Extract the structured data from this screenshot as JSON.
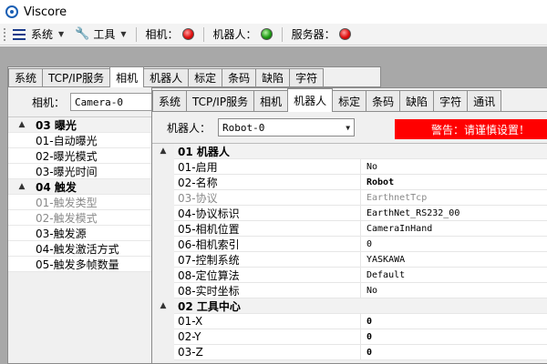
{
  "window": {
    "title": "Viscore"
  },
  "toolbar": {
    "system_label": "系统",
    "tools_label": "工具",
    "camera_label": "相机：",
    "camera_status": "red",
    "robot_label": "机器人：",
    "robot_status": "green",
    "server_label": "服务器：",
    "server_status": "red"
  },
  "back_panel": {
    "tabs": [
      "系统",
      "TCP/IP服务",
      "相机",
      "机器人",
      "标定",
      "条码",
      "缺陷",
      "字符"
    ],
    "active_tab": "相机",
    "camera_label": "相机：",
    "camera_value": "Camera-0",
    "rows": [
      {
        "label": "03  曝光",
        "group": true
      },
      {
        "label": "01-自动曝光"
      },
      {
        "label": "02-曝光模式"
      },
      {
        "label": "03-曝光时间"
      },
      {
        "label": "04  触发",
        "group": true
      },
      {
        "label": "01-触发类型",
        "disabled": true
      },
      {
        "label": "02-触发模式",
        "disabled": true
      },
      {
        "label": "03-触发源"
      },
      {
        "label": "04-触发激活方式"
      },
      {
        "label": "05-触发多帧数量"
      }
    ]
  },
  "front_panel": {
    "tabs": [
      "系统",
      "TCP/IP服务",
      "相机",
      "机器人",
      "标定",
      "条码",
      "缺陷",
      "字符",
      "通讯"
    ],
    "active_tab": "机器人",
    "robot_label": "机器人：",
    "robot_value": "Robot-0",
    "warning": "警告：请谨慎设置！",
    "rows": [
      {
        "key": "01  机器人",
        "group": true
      },
      {
        "key": "01-启用",
        "value": "No"
      },
      {
        "key": "02-名称",
        "value": "Robot",
        "bold": true
      },
      {
        "key": "03-协议",
        "value": "EarthnetTcp",
        "disabled": true
      },
      {
        "key": "04-协议标识",
        "value": "EarthNet_RS232_00"
      },
      {
        "key": "05-相机位置",
        "value": "CameraInHand"
      },
      {
        "key": "06-相机索引",
        "value": "0"
      },
      {
        "key": "07-控制系统",
        "value": "YASKAWA"
      },
      {
        "key": "08-定位算法",
        "value": "Default"
      },
      {
        "key": "08-实时坐标",
        "value": "No"
      },
      {
        "key": "02  工具中心",
        "group": true
      },
      {
        "key": "01-X",
        "value": "0",
        "bold": true
      },
      {
        "key": "02-Y",
        "value": "0",
        "bold": true
      },
      {
        "key": "03-Z",
        "value": "0",
        "bold": true
      }
    ]
  }
}
